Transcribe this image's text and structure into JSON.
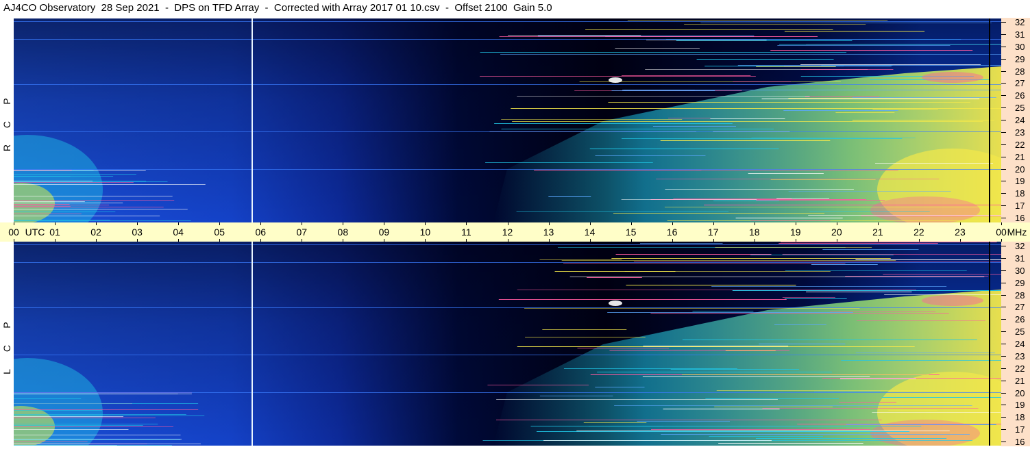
{
  "title": "AJ4CO Observatory  28 Sep 2021  -  DPS on TFD Array  -  Corrected with Array 2017 01 10.csv  -  Offset 2100  Gain 5.0",
  "panels": [
    {
      "id": "rcp",
      "polarization": [
        "R",
        "C",
        "P"
      ]
    },
    {
      "id": "lcp",
      "polarization": [
        "L",
        "C",
        "P"
      ]
    }
  ],
  "time_axis": {
    "labels": [
      "00",
      "01",
      "02",
      "03",
      "04",
      "05",
      "06",
      "07",
      "08",
      "09",
      "10",
      "11",
      "12",
      "13",
      "14",
      "15",
      "16",
      "17",
      "18",
      "19",
      "20",
      "21",
      "22",
      "23",
      "00"
    ],
    "utc_label": "UTC"
  },
  "freq_axis": {
    "labels": [
      "32",
      "31",
      "30",
      "29",
      "28",
      "27",
      "26",
      "25",
      "24",
      "23",
      "22",
      "21",
      "20",
      "19",
      "18",
      "17",
      "16"
    ],
    "unit": "MHz"
  },
  "colors": {
    "background": "#000010",
    "blue": "#1a4fd8",
    "cyan": "#20c8e8",
    "yellow": "#f4e84a",
    "pink": "#ff5aa0",
    "time_bar": "#fffec8",
    "freq_column": "#fde0c8"
  }
}
